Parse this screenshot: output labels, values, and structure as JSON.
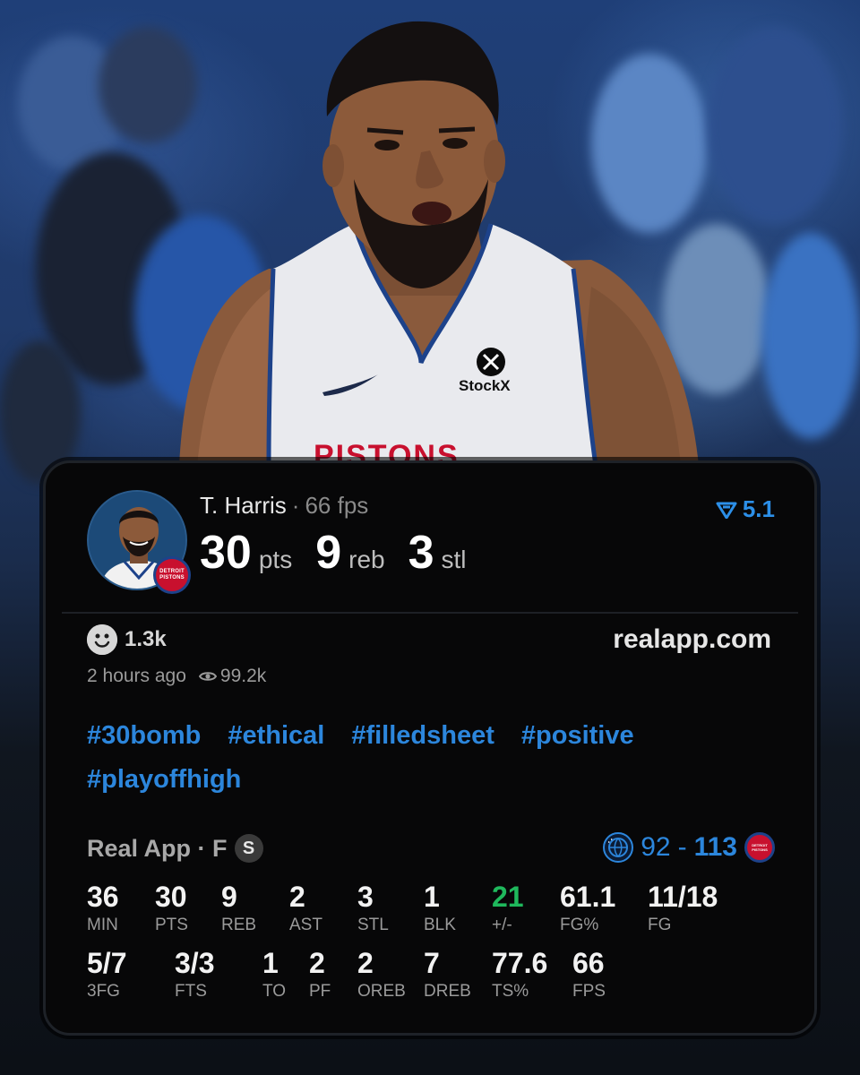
{
  "player": {
    "name": "T. Harris",
    "separator": "·",
    "fps_label": "66 fps",
    "team_badge_text": "DETROIT PISTONS"
  },
  "headline_stats": [
    {
      "value": "30",
      "unit": "pts"
    },
    {
      "value": "9",
      "unit": "reb"
    },
    {
      "value": "3",
      "unit": "stl"
    }
  ],
  "rating": {
    "value": "5.1",
    "icon": "real-rating-icon",
    "color": "#2c8fe8"
  },
  "reactions": {
    "icon": "smiley-icon",
    "count": "1.3k"
  },
  "site": "realapp.com",
  "meta": {
    "time": "2 hours ago",
    "views_icon": "eye-icon",
    "views": "99.2k"
  },
  "tags": [
    "#30bomb",
    "#ethical",
    "#filledsheet",
    "#positive",
    "#playoffhigh"
  ],
  "game": {
    "league_label": "Real App · F",
    "status_badge": "S",
    "away_logo": "orlando-magic-logo",
    "away_score": "92",
    "score_separator": "-",
    "home_score": "113",
    "home_logo": "detroit-pistons-logo",
    "home_logo_text": "DETROIT PISTONS"
  },
  "stats_row_1": [
    {
      "value": "36",
      "label": "MIN"
    },
    {
      "value": "30",
      "label": "PTS"
    },
    {
      "value": "9",
      "label": "REB"
    },
    {
      "value": "2",
      "label": "AST"
    },
    {
      "value": "3",
      "label": "STL"
    },
    {
      "value": "1",
      "label": "BLK"
    },
    {
      "value": "21",
      "label": "+/-",
      "color": "#1fb85c"
    },
    {
      "value": "61.1",
      "label": "FG%"
    },
    {
      "value": "11/18",
      "label": "FG"
    }
  ],
  "stats_row_2": [
    {
      "value": "5/7",
      "label": "3FG"
    },
    {
      "value": "3/3",
      "label": "FTS"
    },
    {
      "value": "1",
      "label": "TO"
    },
    {
      "value": "2",
      "label": "PF"
    },
    {
      "value": "2",
      "label": "OREB"
    },
    {
      "value": "7",
      "label": "DREB"
    },
    {
      "value": "77.6",
      "label": "TS%"
    },
    {
      "value": "66",
      "label": "FPS"
    }
  ],
  "jersey": {
    "sponsor": "StockX",
    "wordmark": "PISTONS"
  },
  "colors": {
    "accent": "#2c86dc",
    "positive": "#1fb85c",
    "pistons_red": "#c8102e",
    "pistons_blue": "#1d428a"
  }
}
